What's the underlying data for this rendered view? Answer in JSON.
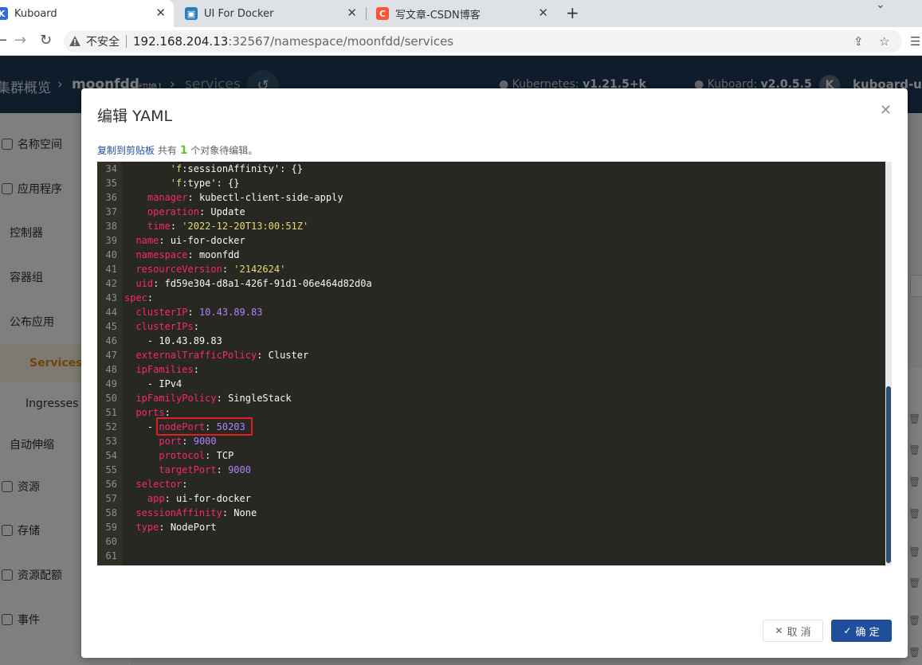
{
  "browser": {
    "tabs": [
      {
        "title": "Kuboard",
        "favicon": "kuboard-icon",
        "active": true
      },
      {
        "title": "UI For Docker",
        "favicon": "docker-icon",
        "active": false
      },
      {
        "title": "写文章-CSDN博客",
        "favicon": "csdn-icon",
        "active": false
      }
    ],
    "address": {
      "security_label": "不安全",
      "host": "192.168.204.13",
      "path": ":32567/namespace/moonfdd/services"
    }
  },
  "app": {
    "breadcrumb": {
      "root": "集群概览",
      "namespace": "moonfdd",
      "switch": "[切换]",
      "page": "services"
    },
    "kubernetes_label": "Kubernetes:",
    "kubernetes_version": "v1.21.5+k",
    "kuboard_label": "Kuboard:",
    "kuboard_version": "v2.0.5.5",
    "user_badge": "K",
    "user": "kuboard-us",
    "sidebar": [
      {
        "label": "名称空间",
        "icon": "home-icon"
      },
      {
        "label": "应用程序",
        "icon": "send-icon"
      },
      {
        "label": "控制器"
      },
      {
        "label": "容器组"
      },
      {
        "label": "公布应用"
      },
      {
        "label": "Services",
        "active": true
      },
      {
        "label": "Ingresses"
      },
      {
        "label": "自动伸缩"
      },
      {
        "label": "资源",
        "icon": "db-icon"
      },
      {
        "label": "存储",
        "icon": "storage-icon"
      },
      {
        "label": "资源配额",
        "icon": "quota-icon"
      },
      {
        "label": "事件",
        "icon": "bell-icon"
      }
    ]
  },
  "modal": {
    "title": "编辑 YAML",
    "copy_link": "复制到剪贴板",
    "info_prefix": "共有",
    "count": "1",
    "info_suffix": "个对象待编辑。",
    "cancel_label": "取 消",
    "confirm_label": "确 定",
    "yaml_lines": [
      {
        "n": "34",
        "t": "        'f:sessionAffinity': {}"
      },
      {
        "n": "35",
        "t": "        'f:type': {}"
      },
      {
        "n": "36",
        "t": "    manager: kubectl-client-side-apply"
      },
      {
        "n": "37",
        "t": "    operation: Update"
      },
      {
        "n": "38",
        "t": "    time: '2022-12-20T13:00:51Z'"
      },
      {
        "n": "39",
        "t": "  name: ui-for-docker"
      },
      {
        "n": "40",
        "t": "  namespace: moonfdd"
      },
      {
        "n": "41",
        "t": "  resourceVersion: '2142624'"
      },
      {
        "n": "42",
        "t": "  uid: fd59e304-d8a1-426f-91d1-06e464d82d0a"
      },
      {
        "n": "43",
        "t": "spec:"
      },
      {
        "n": "44",
        "t": "  clusterIP: 10.43.89.83"
      },
      {
        "n": "45",
        "t": "  clusterIPs:"
      },
      {
        "n": "46",
        "t": "    - 10.43.89.83"
      },
      {
        "n": "47",
        "t": "  externalTrafficPolicy: Cluster"
      },
      {
        "n": "48",
        "t": "  ipFamilies:"
      },
      {
        "n": "49",
        "t": "    - IPv4"
      },
      {
        "n": "50",
        "t": "  ipFamilyPolicy: SingleStack"
      },
      {
        "n": "51",
        "t": "  ports:"
      },
      {
        "n": "52",
        "t": "    - nodePort: 50203"
      },
      {
        "n": "53",
        "t": "      port: 9000"
      },
      {
        "n": "54",
        "t": "      protocol: TCP"
      },
      {
        "n": "55",
        "t": "      targetPort: 9000"
      },
      {
        "n": "56",
        "t": "  selector:"
      },
      {
        "n": "57",
        "t": "    app: ui-for-docker"
      },
      {
        "n": "58",
        "t": "  sessionAffinity: None"
      },
      {
        "n": "59",
        "t": "  type: NodePort"
      },
      {
        "n": "60",
        "t": ""
      },
      {
        "n": "61",
        "t": ""
      }
    ]
  },
  "colors": {
    "header_bg": "#1d3958",
    "accent": "#e08a14",
    "primary_button": "#1f4f9a",
    "editor_bg": "#272822",
    "highlight_box": "#e02020"
  }
}
